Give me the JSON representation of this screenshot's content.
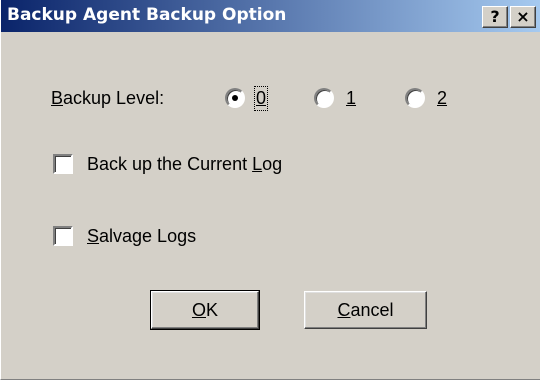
{
  "window": {
    "title": "Backup Agent Backup Option",
    "help_label": "?",
    "close_label": "×"
  },
  "backup_level": {
    "label_prefix": "B",
    "label_rest": "ackup Level:",
    "options": [
      {
        "label": "0",
        "selected": true
      },
      {
        "label": "1",
        "selected": false
      },
      {
        "label": "2",
        "selected": false
      }
    ]
  },
  "checkboxes": {
    "current_log": {
      "label_before": "Back up the Current ",
      "label_ul": "L",
      "label_after": "og",
      "checked": false
    },
    "salvage_logs": {
      "label_ul": "S",
      "label_after": "alvage Logs",
      "checked": false
    }
  },
  "buttons": {
    "ok": {
      "ul": "O",
      "rest": "K"
    },
    "cancel": {
      "ul": "C",
      "rest": "ancel"
    }
  }
}
